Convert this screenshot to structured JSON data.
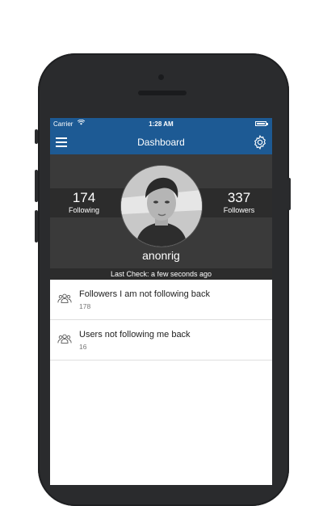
{
  "status_bar": {
    "carrier": "Carrier",
    "time": "1:28 AM"
  },
  "nav": {
    "title": "Dashboard",
    "menu_icon": "hamburger-menu-icon",
    "settings_icon": "gear-icon"
  },
  "profile": {
    "following_count": "174",
    "following_label": "Following",
    "followers_count": "337",
    "followers_label": "Followers",
    "username": "anonrig",
    "last_check": "Last Check: a few seconds ago"
  },
  "list": [
    {
      "title": "Followers I am not following back",
      "count": "178",
      "icon": "users-group-icon"
    },
    {
      "title": "Users not following me back",
      "count": "16",
      "icon": "users-group-icon"
    }
  ],
  "colors": {
    "nav_blue": "#1d5a94",
    "phone_body": "#2a2b2d",
    "profile_bg": "#3a3a3a"
  }
}
